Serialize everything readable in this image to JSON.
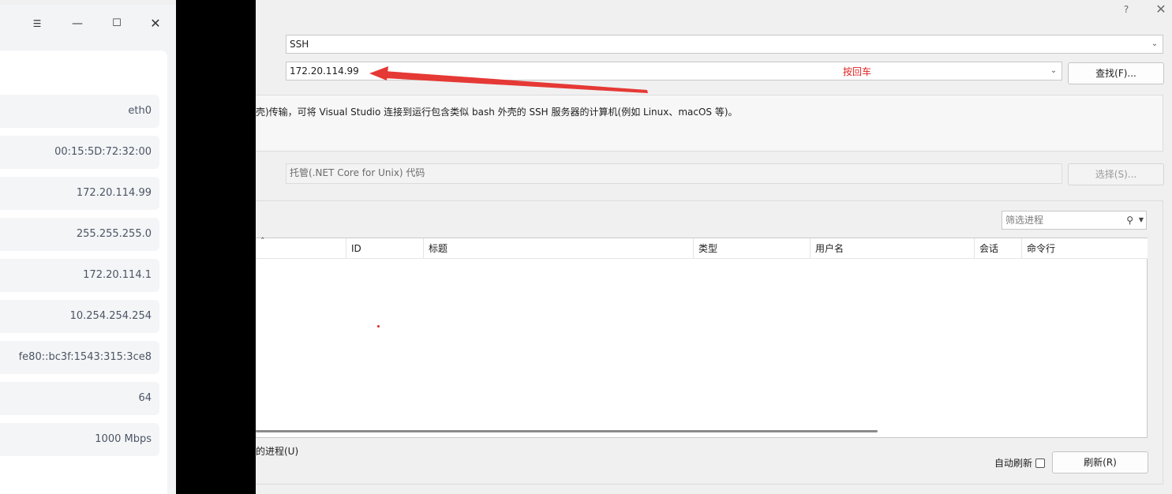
{
  "attach_dialog": {
    "help_glyph": "?",
    "close_glyph": "✕",
    "connection_type": {
      "value": "SSH"
    },
    "connection_target": {
      "value": "172.20.114.99"
    },
    "annotation_hint": "按回车",
    "find_button": "查找(F)...",
    "info_text": "壳)传输，可将 Visual Studio 连接到运行包含类似 bash 外壳的 SSH 服务器的计算机(例如 Linux、macOS 等)。",
    "code_type": {
      "value": "托管(.NET Core for Unix) 代码"
    },
    "select_button": "选择(S)...",
    "process_filter": {
      "placeholder": "筛选进程"
    },
    "columns": [
      "ID",
      "标题",
      "类型",
      "用户名",
      "会话",
      "命令行"
    ],
    "show_all_processes": "的进程(U)",
    "auto_refresh_label": "自动刷新",
    "auto_refresh_checked": false,
    "refresh_button": "刷新(R)",
    "accent_color": "#e02424"
  },
  "network_window": {
    "controls": {
      "menu": "☰",
      "minimize": "—",
      "maximize": "☐",
      "close": "✕"
    },
    "values": [
      "eth0",
      "00:15:5D:72:32:00",
      "172.20.114.99",
      "255.255.255.0",
      "172.20.114.1",
      "10.254.254.254",
      "fe80::bc3f:1543:315:3ce8",
      "64",
      "1000 Mbps"
    ]
  }
}
